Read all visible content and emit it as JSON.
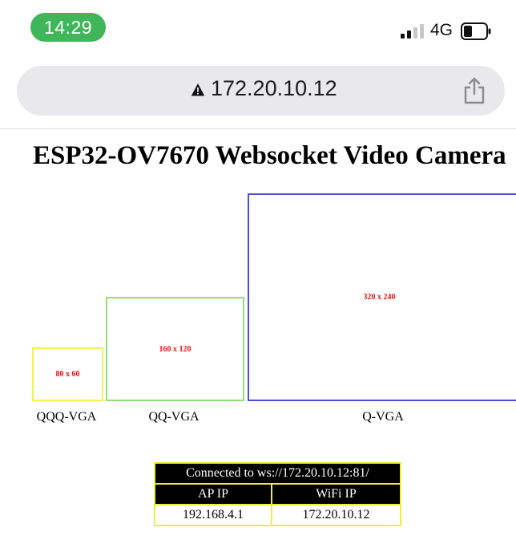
{
  "status_bar": {
    "time": "14:29",
    "network": "4G",
    "signal_bars_active": 2,
    "signal_bars_total": 4,
    "icons": [
      "signal-icon",
      "battery-icon"
    ]
  },
  "address_bar": {
    "url": "172.20.10.12",
    "icons": [
      "warning-icon",
      "share-icon"
    ]
  },
  "page": {
    "title": "ESP32-OV7670 Websocket Video Camera",
    "frames": [
      {
        "size_label": "80 x 60",
        "caption": "QQQ-VGA",
        "border_color": "#f1f05a"
      },
      {
        "size_label": "160 x 120",
        "caption": "QQ-VGA",
        "border_color": "#8fe07a"
      },
      {
        "size_label": "320 x 240",
        "caption": "Q-VGA",
        "border_color": "#4e4ed2"
      }
    ],
    "size_label_color": "#e81313"
  },
  "connection": {
    "status": "Connected to ws://172.20.10.12:81/",
    "headers": [
      "AP IP",
      "WiFi IP"
    ],
    "values": [
      "192.168.4.1",
      "172.20.10.12"
    ],
    "border_color": "#f0ee3c"
  },
  "colors": {
    "time_pill": "#3fb65a",
    "address_bar_bg": "#e9e9ec"
  }
}
